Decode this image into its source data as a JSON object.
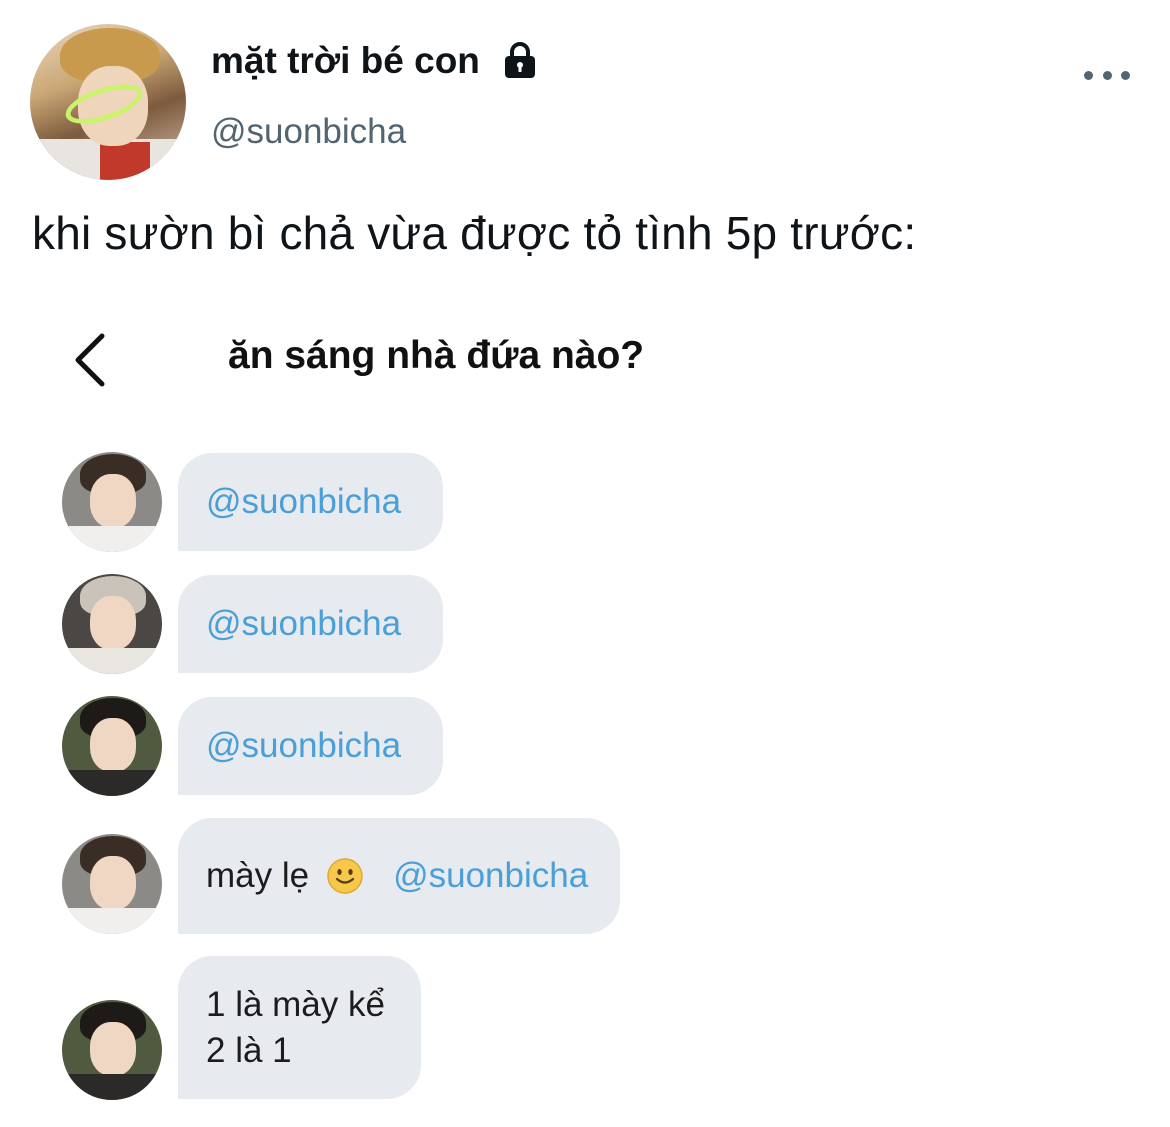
{
  "tweet": {
    "display_name": "mặt trời bé con",
    "handle": "@suonbicha",
    "text": "khi sườn bì chả vừa được tỏ tình 5p trước:",
    "avatar_icon": "user-avatar",
    "lock_icon": "lock-icon",
    "more_icon": "more-horizontal-icon"
  },
  "chat": {
    "title": "ăn sáng nhà đứa nào?",
    "back_icon": "chevron-left-icon",
    "messages": [
      {
        "mention": "@suonbicha"
      },
      {
        "mention": "@suonbicha"
      },
      {
        "mention": "@suonbicha"
      },
      {
        "text": "mày lẹ",
        "emoji": "slightly-smiling-face-icon",
        "mention": "@suonbicha"
      },
      {
        "line1": "1 là mày kể",
        "line2": "2 là 1"
      }
    ]
  },
  "colors": {
    "mention": "#4a9fd8",
    "bubble": "#e7ebef",
    "handle": "#536471"
  }
}
